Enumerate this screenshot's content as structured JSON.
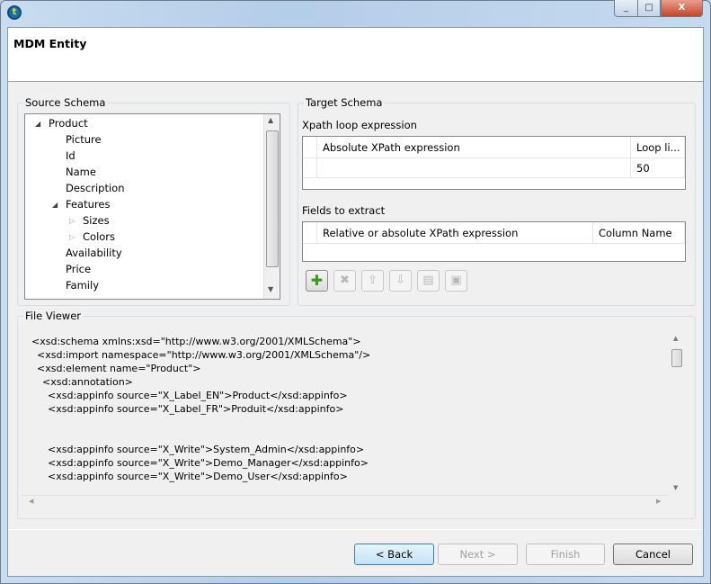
{
  "window": {
    "icon": "talend-icon",
    "minimize": "_",
    "maximize": "□",
    "close": "X"
  },
  "header": {
    "title": "MDM Entity"
  },
  "source": {
    "label": "Source Schema",
    "tree": [
      {
        "label": "Product",
        "level": 0,
        "toggle": "expanded"
      },
      {
        "label": "Picture",
        "level": 1,
        "toggle": "none"
      },
      {
        "label": "Id",
        "level": 1,
        "toggle": "none"
      },
      {
        "label": "Name",
        "level": 1,
        "toggle": "none"
      },
      {
        "label": "Description",
        "level": 1,
        "toggle": "none"
      },
      {
        "label": "Features",
        "level": 1,
        "toggle": "expanded"
      },
      {
        "label": "Sizes",
        "level": 2,
        "toggle": "collapsed"
      },
      {
        "label": "Colors",
        "level": 2,
        "toggle": "collapsed"
      },
      {
        "label": "Availability",
        "level": 1,
        "toggle": "none"
      },
      {
        "label": "Price",
        "level": 1,
        "toggle": "none"
      },
      {
        "label": "Family",
        "level": 1,
        "toggle": "none"
      }
    ]
  },
  "target": {
    "label": "Target Schema",
    "loop_label": "Xpath loop expression",
    "loop_cols": [
      "Absolute XPath expression",
      "Loop li..."
    ],
    "loop_row": {
      "expression": "",
      "limit": "50"
    },
    "fields_label": "Fields to extract",
    "fields_cols": [
      "Relative or absolute XPath expression",
      "Column Name"
    ],
    "toolbar": [
      "add",
      "delete",
      "move-up",
      "move-down",
      "copy",
      "paste"
    ]
  },
  "viewer": {
    "label": "File Viewer",
    "lines": [
      {
        "indent": 0,
        "text": "<xsd:schema xmlns:xsd=\"http://www.w3.org/2001/XMLSchema\">"
      },
      {
        "indent": 1,
        "text": "<xsd:import namespace=\"http://www.w3.org/2001/XMLSchema\"/>"
      },
      {
        "indent": 1,
        "text": "<xsd:element name=\"Product\">"
      },
      {
        "indent": 2,
        "text": "<xsd:annotation>"
      },
      {
        "indent": 3,
        "text": "<xsd:appinfo source=\"X_Label_EN\">Product</xsd:appinfo>"
      },
      {
        "indent": 3,
        "text": "<xsd:appinfo source=\"X_Label_FR\">Produit</xsd:appinfo>"
      },
      {
        "indent": 3,
        "text": ""
      },
      {
        "indent": 3,
        "text": ""
      },
      {
        "indent": 3,
        "text": "<xsd:appinfo source=\"X_Write\">System_Admin</xsd:appinfo>"
      },
      {
        "indent": 3,
        "text": "<xsd:appinfo source=\"X_Write\">Demo_Manager</xsd:appinfo>"
      },
      {
        "indent": 3,
        "text": "<xsd:appinfo source=\"X_Write\">Demo_User</xsd:appinfo>"
      }
    ]
  },
  "buttons": {
    "back": "< Back",
    "next": "Next >",
    "finish": "Finish",
    "cancel": "Cancel"
  }
}
